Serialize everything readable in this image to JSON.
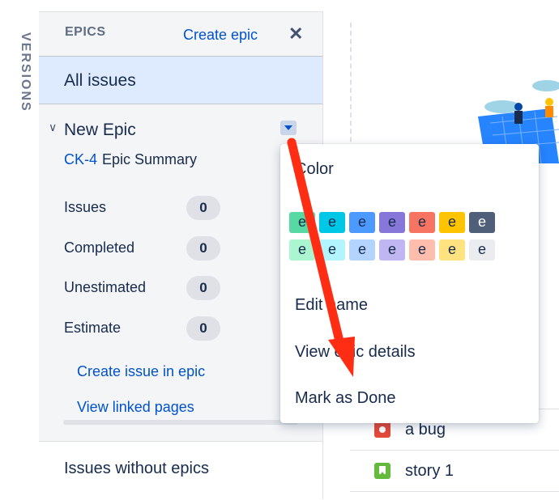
{
  "sidebar": {
    "versions_label": "VERSIONS"
  },
  "epics_panel": {
    "header_label": "EPICS",
    "create_epic_label": "Create epic",
    "close_label": "✕",
    "all_issues_label": "All issues",
    "epic": {
      "name": "New Epic",
      "key": "CK-4",
      "summary": "Epic Summary",
      "stats": [
        {
          "label": "Issues",
          "value": "0"
        },
        {
          "label": "Completed",
          "value": "0"
        },
        {
          "label": "Unestimated",
          "value": "0"
        },
        {
          "label": "Estimate",
          "value": "0"
        }
      ],
      "create_issue_link": "Create issue in epic",
      "view_pages_link": "View linked pages"
    },
    "issues_without_epics_label": "Issues without epics"
  },
  "epic_menu": {
    "color_label": "Color",
    "swatch_letter": "e",
    "colors_row1": [
      "#57d9a3",
      "#00c7e6",
      "#4c9aff",
      "#8777d9",
      "#f87462",
      "#ffc400",
      "#505f79"
    ],
    "colors_row2": [
      "#abf5d1",
      "#b3f5ff",
      "#b3d4ff",
      "#c0b6f2",
      "#ffbdad",
      "#ffe380",
      "#ebecf0"
    ],
    "edit_name": "Edit name",
    "view_details": "View epic details",
    "mark_done": "Mark as Done"
  },
  "board": {
    "issues": [
      {
        "type": "bug",
        "title": "a bug"
      },
      {
        "type": "story",
        "title": "story 1"
      }
    ]
  },
  "colors": {
    "annotation_arrow": "#ff2d14"
  }
}
